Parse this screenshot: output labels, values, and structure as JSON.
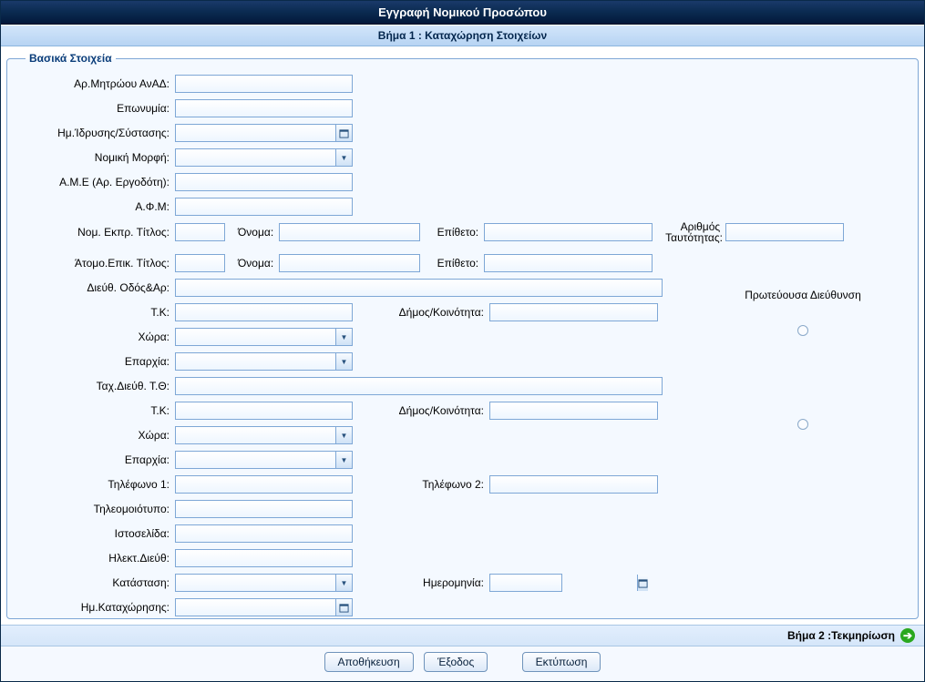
{
  "window": {
    "title": "Εγγραφή Νομικού Προσώπου",
    "step": "Βήμα 1 : Καταχώρηση Στοιχείων"
  },
  "group": {
    "legend": "Βασικά Στοιχεία"
  },
  "labels": {
    "registry_no": "Αρ.Μητρώου ΑνΑΔ:",
    "name": "Επωνυμία:",
    "founding_date": "Ημ.Ίδρυσης/Σύστασης:",
    "legal_form": "Νομική Μορφή:",
    "ame": "Α.Μ.Ε (Αρ. Εργοδότη):",
    "afm": "Α.Φ.Μ:",
    "legal_rep": "Νομ. Εκπρ.",
    "contact_person": "Άτομο.Επικ.",
    "title": "Τίτλος:",
    "first_name": "Όνομα:",
    "last_name": "Επίθετο:",
    "id_number": "Αριθμός Ταυτότητας:",
    "address": "Διεύθ.",
    "street_no": "Οδός&Αρ:",
    "postal": "Τ.Κ:",
    "municipality": "Δήμος/Κοινότητα:",
    "country": "Χώρα:",
    "district": "Επαρχία:",
    "pobox": "Ταχ.Διεύθ. Τ.Θ:",
    "phone1": "Τηλέφωνο 1:",
    "phone2": "Τηλέφωνο 2:",
    "fax": "Τηλεομοιότυπο:",
    "website": "Ιστοσελίδα:",
    "email": "Ηλεκτ.Διεύθ:",
    "status": "Κατάσταση:",
    "date": "Ημερομηνία:",
    "reg_date": "Ημ.Καταχώρησης:",
    "primary_addr": "Πρωτεύουσα Διεύθυνση"
  },
  "values": {
    "registry_no": "",
    "name": "",
    "founding_date": "",
    "legal_form": "",
    "ame": "",
    "afm": "",
    "rep_title": "",
    "rep_first": "",
    "rep_last": "",
    "rep_id": "",
    "contact_title": "",
    "contact_first": "",
    "contact_last": "",
    "addr_street": "",
    "addr_postal": "",
    "addr_muni": "",
    "addr_country": "",
    "addr_district": "",
    "pobox": "",
    "pobox_postal": "",
    "pobox_muni": "",
    "pobox_country": "",
    "pobox_district": "",
    "phone1": "",
    "phone2": "",
    "fax": "",
    "website": "",
    "email": "",
    "status": "",
    "status_date": "",
    "reg_date": ""
  },
  "footer": {
    "next_step": "Βήμα 2 :Τεκμηρίωση",
    "save": "Αποθήκευση",
    "exit": "Έξοδος",
    "print": "Εκτύπωση"
  }
}
